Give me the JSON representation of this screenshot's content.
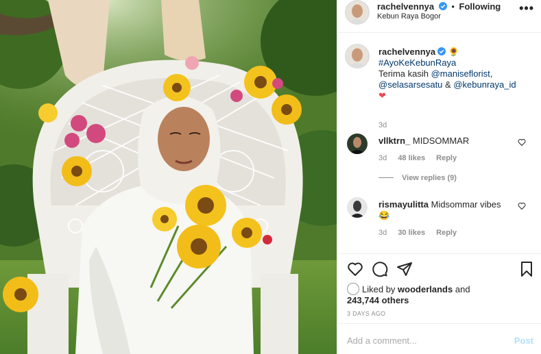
{
  "post": {
    "username": "rachelvennya",
    "follow_status": "Following",
    "location": "Kebun Raya Bogor",
    "more_label": "•••"
  },
  "caption": {
    "username": "rachelvennya",
    "emoji": "🌻",
    "hashtag": "#AyoKeKebunRaya",
    "text_prefix": "Terima kasih",
    "mention1": "@maniseflorist,",
    "mention2": "@selasarsesatu",
    "amp": "&",
    "mention3": "@kebunraya_id",
    "heart": "❤",
    "time": "3d"
  },
  "comments": [
    {
      "username": "vllktrn_",
      "text": "MIDSOMMAR",
      "time": "3d",
      "likes": "48 likes",
      "reply": "Reply"
    },
    {
      "username": "rismayulitta",
      "text": "Midsommar vibes",
      "emoji": "😂",
      "time": "3d",
      "likes": "30 likes",
      "reply": "Reply"
    }
  ],
  "view_replies": "View replies (9)",
  "likes": {
    "prefix": "Liked by",
    "user": "wooderlands",
    "and": "and",
    "count": "243,744 others"
  },
  "posted_ago": "3 DAYS AGO",
  "add_comment": {
    "placeholder": "Add a comment...",
    "post_label": "Post"
  },
  "icons": {
    "verified": "verified-badge-icon",
    "like": "heart-icon",
    "comment": "comment-bubble-icon",
    "share": "paper-plane-icon",
    "save": "bookmark-icon"
  },
  "colors": {
    "verified": "#3897f0",
    "link": "#00376b",
    "post_btn": "#b2dffc",
    "heart": "#ed4956"
  }
}
